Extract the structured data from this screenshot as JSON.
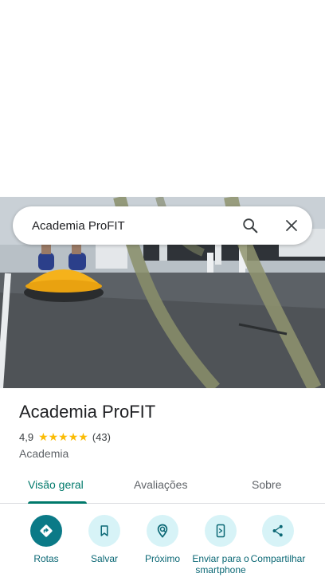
{
  "search": {
    "query": "Academia ProFIT",
    "search_icon": "search-icon",
    "close_icon": "close-icon"
  },
  "place": {
    "name": "Academia ProFIT",
    "rating": "4,9",
    "stars": "★★★★★",
    "review_count": "(43)",
    "category": "Academia"
  },
  "tabs": [
    {
      "label": "Visão geral",
      "active": true
    },
    {
      "label": "Avaliações",
      "active": false
    },
    {
      "label": "Sobre",
      "active": false
    }
  ],
  "actions": [
    {
      "label": "Rotas",
      "icon": "directions-icon"
    },
    {
      "label": "Salvar",
      "icon": "bookmark-icon"
    },
    {
      "label": "Próximo",
      "icon": "nearby-icon"
    },
    {
      "label": "Enviar para o smartphone",
      "icon": "send-to-phone-icon"
    },
    {
      "label": "Compartilhar",
      "icon": "share-icon"
    }
  ],
  "colors": {
    "accent": "#00796b",
    "action_primary": "#0b7a87",
    "action_bg": "#d7f3f7",
    "stars": "#fbbc04"
  }
}
